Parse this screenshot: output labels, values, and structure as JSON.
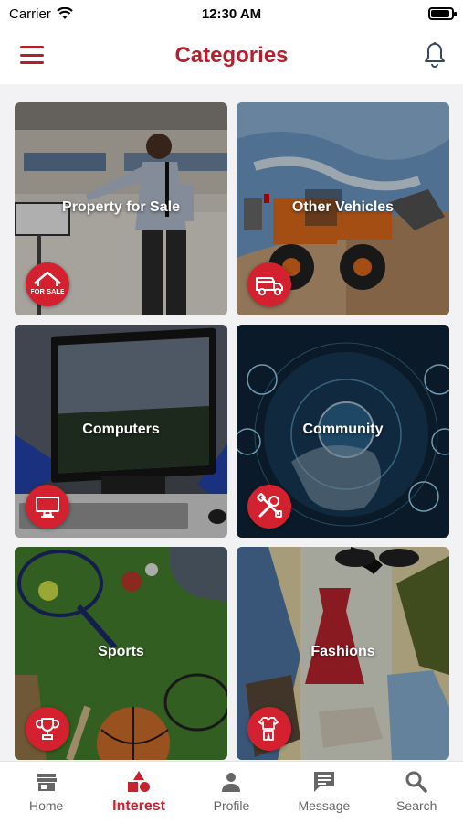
{
  "status_bar": {
    "carrier": "Carrier",
    "time": "12:30 AM"
  },
  "header": {
    "title": "Categories"
  },
  "categories": [
    {
      "label": "Property for Sale",
      "icon": "for-sale-house-icon"
    },
    {
      "label": "Other Vehicles",
      "icon": "truck-icon"
    },
    {
      "label": "Computers",
      "icon": "monitor-icon"
    },
    {
      "label": "Community",
      "icon": "tools-icon"
    },
    {
      "label": "Sports",
      "icon": "trophy-icon"
    },
    {
      "label": "Fashions",
      "icon": "clothing-icon"
    }
  ],
  "badge_text": {
    "for_sale": "FOR SALE"
  },
  "tabs": [
    {
      "label": "Home",
      "icon": "store-icon",
      "active": false
    },
    {
      "label": "Interest",
      "icon": "shapes-icon",
      "active": true
    },
    {
      "label": "Profile",
      "icon": "person-icon",
      "active": false
    },
    {
      "label": "Message",
      "icon": "chat-icon",
      "active": false
    },
    {
      "label": "Search",
      "icon": "search-icon",
      "active": false
    }
  ],
  "colors": {
    "accent": "#b3202c",
    "badge": "#d3212f",
    "background": "#f2f2f5"
  }
}
